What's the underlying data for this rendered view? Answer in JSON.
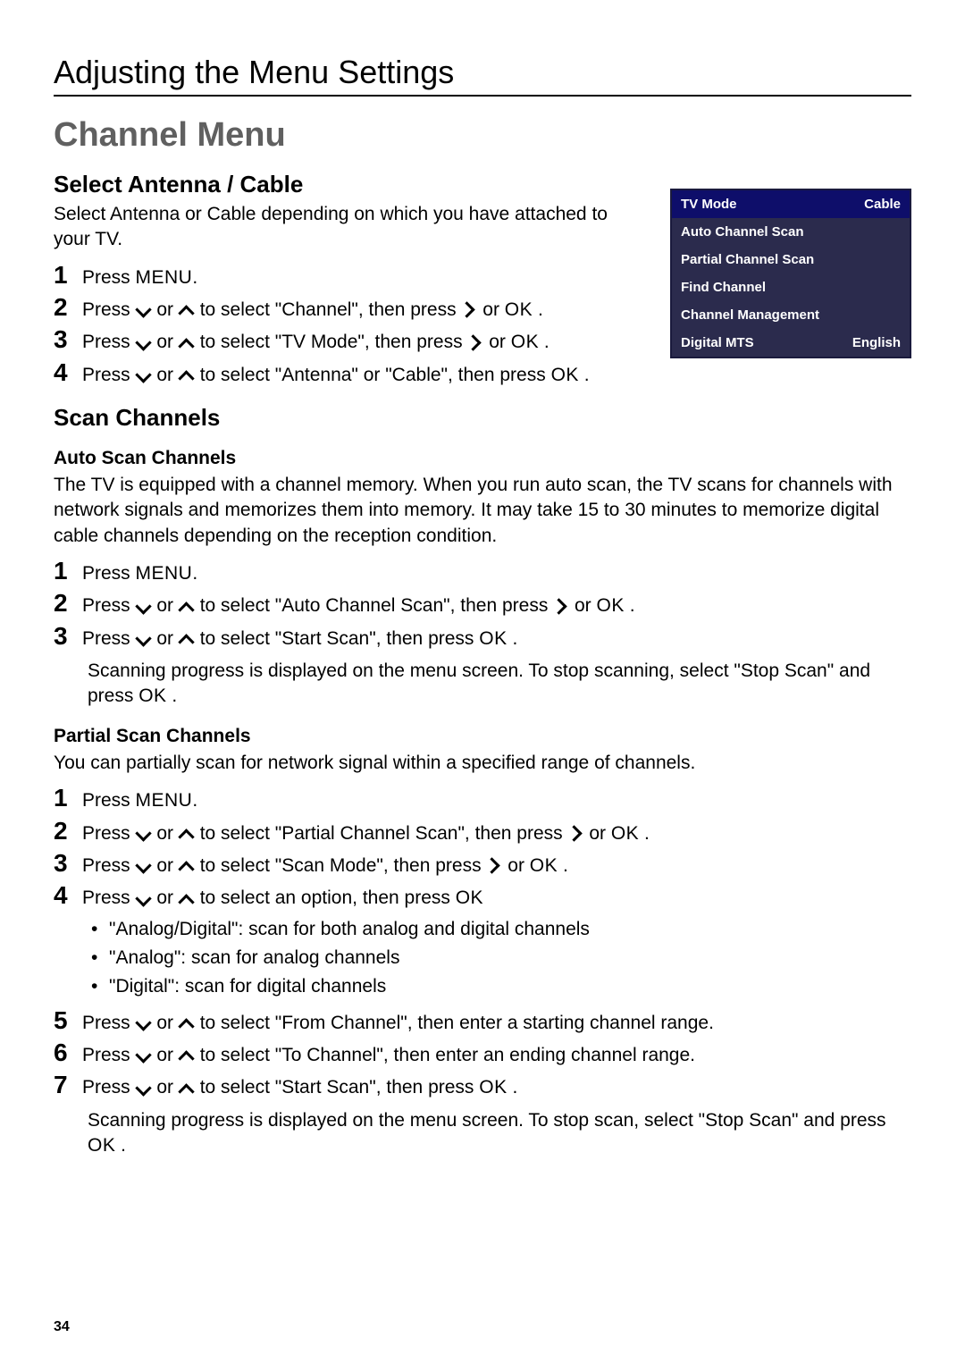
{
  "section_header": "Adjusting the Menu Settings",
  "main_title": "Channel Menu",
  "tv_menu": {
    "rows": [
      {
        "label": "TV Mode",
        "value": "Cable"
      },
      {
        "label": "Auto Channel Scan",
        "value": ""
      },
      {
        "label": "Partial Channel Scan",
        "value": ""
      },
      {
        "label": "Find Channel",
        "value": ""
      },
      {
        "label": "Channel Management",
        "value": ""
      },
      {
        "label": "Digital MTS",
        "value": "English"
      }
    ]
  },
  "select_antenna": {
    "title": "Select Antenna / Cable",
    "intro": "Select Antenna or Cable depending on which you have attached to your TV.",
    "steps": {
      "s1_a": "Press ",
      "s1_b": ".",
      "s2_a": "Press ",
      "s2_b": " or ",
      "s2_c": " to select \"Channel\", then press ",
      "s2_d": " or ",
      "s2_e": " .",
      "s3_a": "Press ",
      "s3_b": " or ",
      "s3_c": " to select \"TV Mode\", then press ",
      "s3_d": " or ",
      "s3_e": " .",
      "s4_a": "Press ",
      "s4_b": " or ",
      "s4_c": " to select \"Antenna\" or \"Cable\", then press ",
      "s4_d": " ."
    }
  },
  "scan_channels": {
    "title": "Scan Channels",
    "auto": {
      "title": "Auto Scan Channels",
      "intro": "The TV is equipped with a channel memory. When you run auto scan, the TV scans for channels with network signals and memorizes them into memory. It may take 15 to 30 minutes to memorize digital cable channels depending on the reception condition.",
      "steps": {
        "s1_a": "Press ",
        "s1_b": ".",
        "s2_a": "Press ",
        "s2_b": " or ",
        "s2_c": " to select \"Auto Channel Scan\", then press ",
        "s2_d": " or ",
        "s2_e": " .",
        "s3_a": "Press ",
        "s3_b": " or ",
        "s3_c": " to select \"Start Scan\", then press ",
        "s3_d": " ."
      },
      "note_a": "Scanning progress is displayed on the menu screen. To stop scanning, select \"Stop Scan\" and press ",
      "note_b": " ."
    },
    "partial": {
      "title": "Partial Scan Channels",
      "intro": "You can partially scan for network signal within a specified range of channels.",
      "steps": {
        "s1_a": "Press ",
        "s1_b": ".",
        "s2_a": "Press ",
        "s2_b": " or ",
        "s2_c": " to select \"Partial Channel Scan\", then press ",
        "s2_d": " or ",
        "s2_e": " .",
        "s3_a": "Press ",
        "s3_b": " or ",
        "s3_c": " to select \"Scan Mode\", then press ",
        "s3_d": " or ",
        "s3_e": " .",
        "s4_a": "Press ",
        "s4_b": " or ",
        "s4_c": " to select an option, then press ",
        "b1": "\"Analog/Digital\": scan for both analog and digital channels",
        "b2": "\"Analog\": scan for analog channels",
        "b3": "\"Digital\": scan for digital channels",
        "s5_a": "Press ",
        "s5_b": " or ",
        "s5_c": " to select \"From Channel\", then enter a starting channel range.",
        "s6_a": "Press ",
        "s6_b": " or ",
        "s6_c": " to select \"To Channel\", then enter an ending channel range.",
        "s7_a": "Press ",
        "s7_b": " or ",
        "s7_c": " to select \"Start Scan\", then press ",
        "s7_d": " ."
      },
      "note_a": "Scanning progress is displayed on the menu screen. To stop scan, select \"Stop Scan\" and press ",
      "note_b": " ."
    }
  },
  "keys": {
    "menu": "MENU",
    "ok": "OK"
  },
  "page_number": "34"
}
